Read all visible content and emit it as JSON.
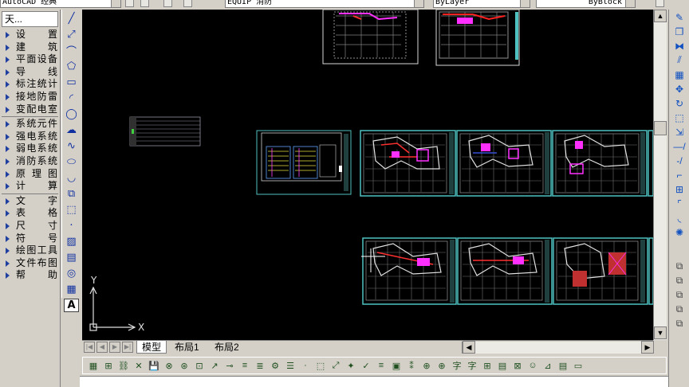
{
  "top_toolbar": {
    "workspace_value": "AutoCAD 经典",
    "layer_value": "EQUIP 消防",
    "color_value": "ByLayer",
    "linetype_value": "ByBlock"
  },
  "side_panel": {
    "title": "天...",
    "groups": [
      [
        "设 置",
        "建 筑",
        "平面设备",
        "导 线",
        "标注统计",
        "接地防雷",
        "变配电室"
      ],
      [
        "系统元件",
        "强电系统",
        "弱电系统",
        "消防系统",
        "原 理 图",
        "计 算"
      ],
      [
        "文 字",
        "表 格",
        "尺 寸",
        "符 号",
        "绘图工具",
        "文件布图",
        "帮 助"
      ]
    ]
  },
  "draw_toolbar": {
    "icons": [
      "line-icon",
      "construction-line-icon",
      "polyline-icon",
      "polygon-icon",
      "rectangle-icon",
      "arc-icon",
      "circle-icon",
      "revision-cloud-icon",
      "spline-icon",
      "ellipse-icon",
      "ellipse-arc-icon",
      "insert-block-icon",
      "make-block-icon",
      "point-icon",
      "hatch-icon",
      "gradient-icon",
      "region-icon",
      "table-icon",
      "multiline-text-icon"
    ],
    "glyphs": [
      "╱",
      "⤢",
      "⌒",
      "⬠",
      "▭",
      "◜",
      "◯",
      "☁",
      "∿",
      "⬭",
      "◡",
      "⧉",
      "⬚",
      "·",
      "▨",
      "▤",
      "◎",
      "▦",
      "A"
    ]
  },
  "canvas": {
    "ucs_y": "Y",
    "ucs_x": "X"
  },
  "layout_tabs": {
    "tabs": [
      "模型",
      "布局1",
      "布局2"
    ],
    "active": "模型"
  },
  "colors": {
    "canvas_bg": "#000000",
    "sheet_border": "#4fc0c0",
    "ui_face": "#d4d0c8"
  }
}
